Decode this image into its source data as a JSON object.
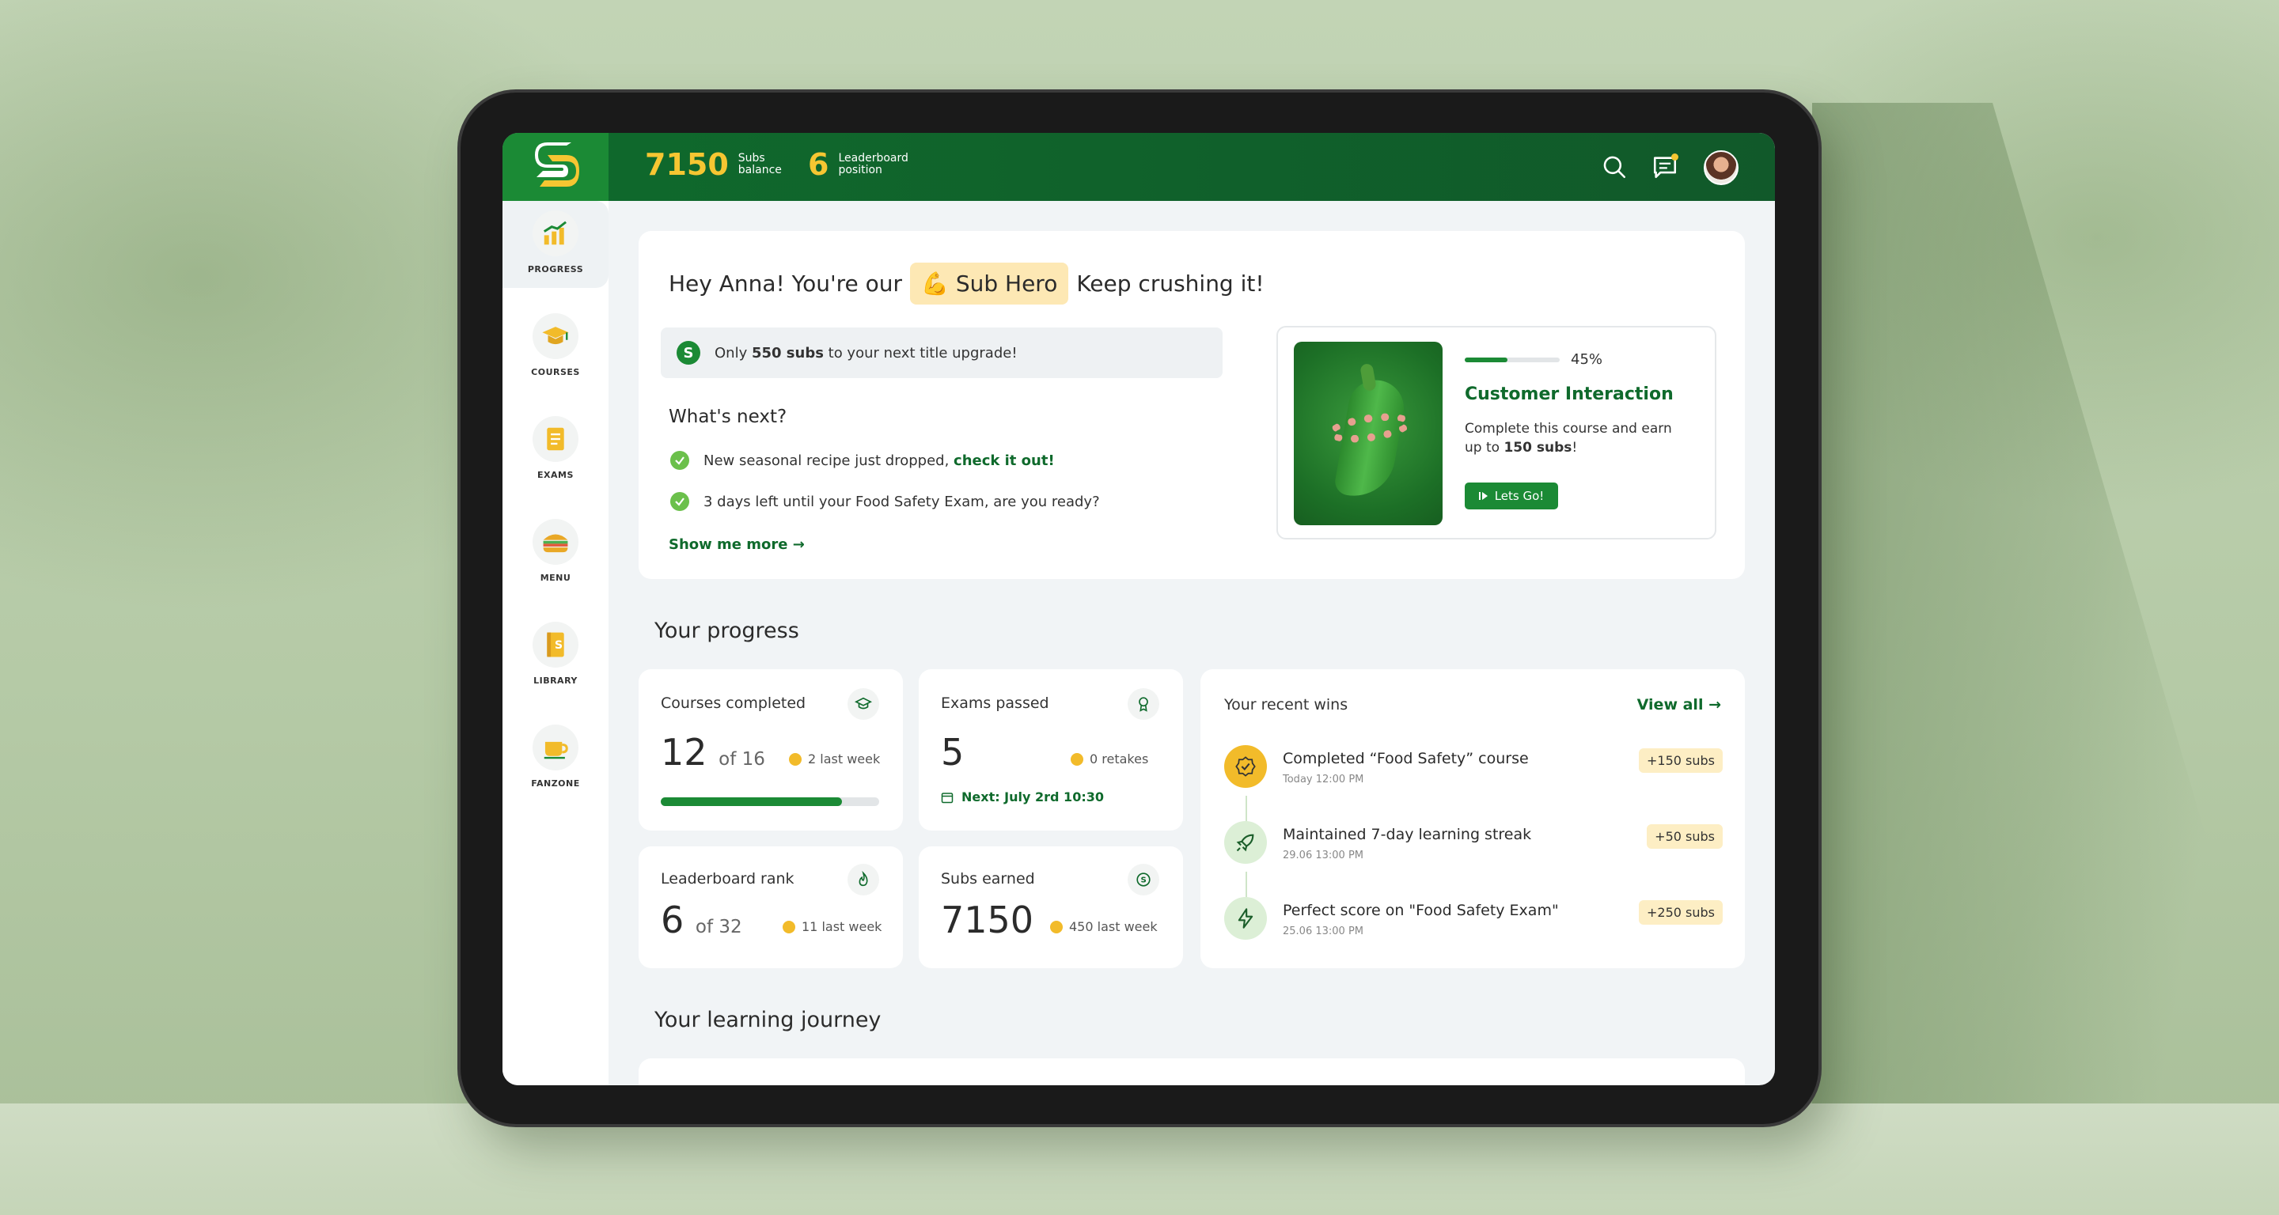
{
  "topbar": {
    "subs_balance_value": "7150",
    "subs_balance_label": "Subs balance",
    "leaderboard_value": "6",
    "leaderboard_label": "Leaderboard position"
  },
  "sidebar": {
    "items": [
      {
        "label": "PROGRESS",
        "icon": "chart-icon"
      },
      {
        "label": "COURSES",
        "icon": "graduation-cap-icon"
      },
      {
        "label": "EXAMS",
        "icon": "clipboard-icon"
      },
      {
        "label": "MENU",
        "icon": "sandwich-icon"
      },
      {
        "label": "LIBRARY",
        "icon": "book-icon"
      },
      {
        "label": "FANZONE",
        "icon": "cup-icon"
      }
    ]
  },
  "hero": {
    "greeting_pre": "Hey Anna! You're our",
    "badge": "💪 Sub Hero",
    "greeting_post": "Keep crushing it!",
    "upgrade_pre": "Only ",
    "upgrade_bold": "550 subs",
    "upgrade_post": " to your next title upgrade!",
    "whats_next": "What's next?",
    "next_items": [
      {
        "pre": "New seasonal recipe just dropped, ",
        "link": "check it out!"
      },
      {
        "pre": "3 days left until your Food Safety Exam, are you ready?",
        "link": ""
      }
    ],
    "show_more": "Show me more →"
  },
  "course": {
    "progress_pct": 45,
    "progress_label": "45%",
    "title": "Customer Interaction",
    "desc_pre": "Complete this course and earn up to ",
    "desc_bold": "150 subs",
    "desc_post": "!",
    "button": "Lets Go!"
  },
  "progress_section": {
    "title": "Your progress",
    "courses_completed": {
      "label": "Courses completed",
      "value": "12",
      "of": "of 16",
      "note": "2 last week",
      "fraction": 0.83
    },
    "exams_passed": {
      "label": "Exams passed",
      "value": "5",
      "note": "0 retakes",
      "next": "Next: July 2rd 10:30"
    },
    "leaderboard_rank": {
      "label": "Leaderboard rank",
      "value": "6",
      "of": "of 32",
      "note": "11 last week"
    },
    "subs_earned": {
      "label": "Subs earned",
      "value": "7150",
      "note": "450 last week"
    }
  },
  "wins": {
    "title": "Your recent wins",
    "view_all": "View all →",
    "items": [
      {
        "text": "Completed “Food Safety” course",
        "time": "Today 12:00 PM",
        "badge": "+150 subs",
        "icon": "check-badge-icon",
        "color": "#f2bb2a"
      },
      {
        "text": "Maintained 7-day learning streak",
        "time": "29.06 13:00 PM",
        "badge": "+50 subs",
        "icon": "rocket-icon",
        "color": "#dcefd6"
      },
      {
        "text": "Perfect score on \"Food Safety Exam\"",
        "time": "25.06 13:00 PM",
        "badge": "+250 subs",
        "icon": "lightning-icon",
        "color": "#dcefd6"
      }
    ]
  },
  "journey": {
    "title": "Your learning journey"
  },
  "colors": {
    "brand_green": "#1b8a35",
    "dark_green": "#0f6a2c",
    "accent_yellow": "#f6c632"
  }
}
